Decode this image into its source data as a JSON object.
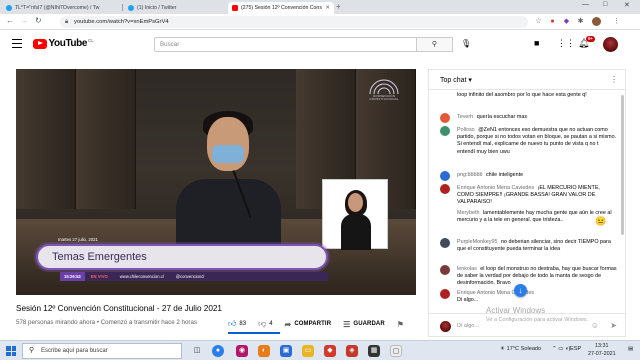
{
  "browser": {
    "tabs": [
      {
        "label": "TL*T=\"nfsI7 (@NIhl7Overcome) / Tw",
        "favicon_color": "#1da1f2",
        "active": false
      },
      {
        "label": "(1) Inicio / Twitter",
        "favicon_color": "#1da1f2",
        "active": false
      },
      {
        "label": "(275) Sesión 12º Convención Cons",
        "favicon_color": "#ff0000",
        "active": true
      }
    ],
    "new_tab": "+",
    "window_controls": [
      "—",
      "□",
      "✕"
    ],
    "url": "youtube.com/watch?v=xnEmPsGrV4",
    "nav": [
      "←",
      "→",
      "↻"
    ]
  },
  "youtube": {
    "logo_text": "YouTube",
    "country": "CL",
    "search_placeholder": "Buscar",
    "notifications_count": "9+"
  },
  "video": {
    "overlay_date": "martes 27 julio, 2021",
    "overlay_title": "Temas Emergentes",
    "overlay_time": "15:26:53",
    "overlay_live": "EN VIVO",
    "overlay_site": "www.chileconvencion.cl",
    "overlay_handle": "@convencioncl",
    "seal_text_1": "CONVENCIÓN",
    "seal_text_2": "CONSTITUCIONAL",
    "title": "Sesión 12º Convención Constitucional - 27 de Julio 2021",
    "meta": "578 personas mirando ahora • Comenzó a transmitir hace 2 horas",
    "likes": "83",
    "dislikes": "4",
    "share_label": "COMPARTIR",
    "save_label": "GUARDAR"
  },
  "chat": {
    "title": "Top chat",
    "messages": [
      {
        "author": "",
        "text": "loop infinito del asombro por lo que hace esta gente q!",
        "avatar_color": ""
      },
      {
        "author": "Teverh",
        "text": "quería escuchar mas",
        "avatar_color": "#e05a3a"
      },
      {
        "author": "Polloso",
        "text": "@ZeN1 entonces eso demuestra que no actuan como partido, porque si no todos votan en bloque, se pautan a si mismo. Si entendí mal, explicame de nuevo tu punto de vista q no t entendí muy bien uwu",
        "avatar_color": "#3f8f6a"
      },
      {
        "author": "png:ḃḃḃḃḃ",
        "text": "chile inteligente",
        "avatar_color": "#2b6cd4"
      },
      {
        "author": "Enrique Antonio Mena Caviedes",
        "text": "¡EL MERCURIO MIENTE, COMO SIEMPRE!! ¡GRANDE BASSA! GRAN VALOR DE VALPARAISO!",
        "avatar_color": "#b02020"
      },
      {
        "author": "Merybeth",
        "text": "lamentablemente hay mucha gente que aún le cree al mercurio y a la tele en general. que tristeza..",
        "avatar_color": ""
      },
      {
        "author": "PurpleMonkey95",
        "text": "no deberian silenciar, sino decir TIEMPO para que el constituyente pueda terminar la idea",
        "avatar_color": "#404a5a"
      },
      {
        "author": "lenkolas",
        "text": "el loop del monstruo no destraba, hay que buscar formas de saber la verdad por debajo de todo la manta de sesgo de desinformación. Bravo",
        "avatar_color": "#7a3a3a"
      },
      {
        "author": "Enrique Antonio Mena Caviedes",
        "text": "Di algo...",
        "avatar_color": "#b02020"
      }
    ],
    "input_placeholder": "Di algo...",
    "emoji": "😐"
  },
  "activation": {
    "title": "Activar Windows",
    "subtitle": "Ve a Configuración para activar Windows."
  },
  "taskbar": {
    "search_placeholder": "Escribe aquí para buscar",
    "weather": "17°C Soleado",
    "lang": "ESP",
    "time": "13:31",
    "date": "27-07-2021"
  }
}
